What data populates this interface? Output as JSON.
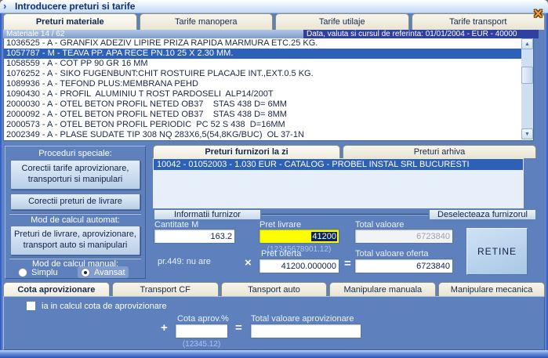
{
  "window": {
    "title": "Introducere preturi si tarife"
  },
  "icons": {
    "app": "›",
    "close": "✕",
    "scroll_up": "▲",
    "scroll_down": "▼"
  },
  "main_tabs": {
    "items": [
      "Preturi materiale",
      "Tarife manopera",
      "Tarife utilaje",
      "Tarife transport"
    ]
  },
  "materials": {
    "counter": "Materiale 14 / 62",
    "reference": "Data, valuta si cursul de referinta: 01/01/2004 - EUR - 40000",
    "items": [
      "1036525 - A - GRANFIX ADEZIV LIPIRE PRIZA RAPIDA MARMURA ETC.25 KG.",
      "1057787 - M - TEAVA PP. APA RECE PN.10 25 X 2.30 MM.",
      "1058559 - A - COT PP 90 GR 16 MM",
      "1076252 - A - SIKO FUGENBUNT:CHIT ROSTUIRE PLACAJE INT.,EXT.0.5 KG.",
      "1089936 - A - TEFOND PLUS:MEMBRANA PEHD",
      "1090430 - A - PROFIL  ALUMINIU T ROST PARDOSELI  ALP14/200T",
      "2000030 - A - OTEL BETON PROFIL NETED OB37    STAS 438 D= 6MM",
      "2000092 - A - OTEL BETON PROFIL NETED OB37    STAS 438 D= 8MM",
      "2000573 - A - OTEL BETON PROFIL PERIODIC  PC 52 S 438  D=16MM",
      "2002349 - A - PLASE SUDATE TIP 308 NQ 283X6,5(54,8KG/BUC)  OL 37-1N"
    ]
  },
  "left_panel": {
    "special_heading": "Proceduri speciale:",
    "btn_corectii_tarife": "Corectii tarife aprovizionare, transporturi  si manipulari",
    "btn_corectii_preturi": "Corectii preturi de livrare",
    "auto_heading": "Mod de calcul automat:",
    "btn_preturi_livrare": "Preturi de livrare, aprovizionare, transport auto si manipulari",
    "manual_heading": "Mod de calcul manual:",
    "radio_simplu": "Simplu",
    "radio_avansat": "Avansat"
  },
  "suppliers": {
    "tab_zi": "Preturi furnizori la zi",
    "tab_arhiva": "Preturi arhiva",
    "row": "10042 - 01052003 - 1.030 EUR - CATALOG - PROBEL INSTAL SRL BUCURESTI",
    "info_button": "Informatii furnizor",
    "deselect_button": "Deselecteaza furnizorul"
  },
  "calc": {
    "cantitate_label": "Cantitate M",
    "cantitate_value": "163.2",
    "pret_livrare_label": "Pret livrare",
    "pret_livrare_value": "41200",
    "total_valoare_label": "Total valoare",
    "total_valoare_value": "6723840",
    "format_hint": "(12345678901.12)",
    "pr449": "pr.449: nu are",
    "times": "×",
    "equals": "=",
    "pret_oferta_label": "Pret oferta",
    "pret_oferta_value": "41200.000000",
    "total_oferta_label": "Total valoare oferta",
    "total_oferta_value": "6723840",
    "retine_button": "RETINE"
  },
  "bottom_tabs": {
    "items": [
      "Cota aprovizionare",
      "Transport CF",
      "Tansport auto",
      "Manipulare manuala",
      "Manipulare mecanica"
    ]
  },
  "cota": {
    "checkbox_label": "ia in calcul cota de aprovizionare",
    "plus": "+",
    "equals": "=",
    "cota_label": "Cota aprov.%",
    "cota_value": "",
    "format_hint": "(12345.12)",
    "total_label": "Total valoare aprovizionare",
    "total_value": ""
  }
}
